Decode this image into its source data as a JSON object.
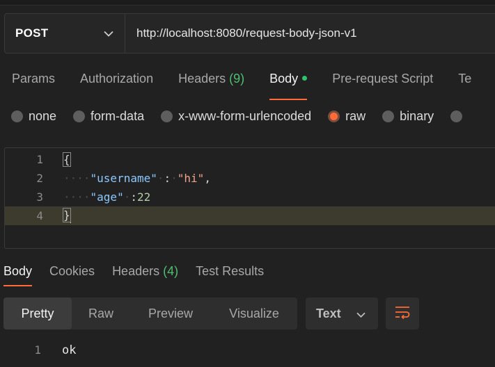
{
  "request": {
    "method": "POST",
    "url": "http://localhost:8080/request-body-json-v1"
  },
  "request_tabs": {
    "params": "Params",
    "authorization": "Authorization",
    "headers": "Headers",
    "headers_count": "(9)",
    "body": "Body",
    "pre_request": "Pre-request Script",
    "tests_partial": "Te"
  },
  "body_types": {
    "none": "none",
    "form_data": "form-data",
    "urlencoded": "x-www-form-urlencoded",
    "raw": "raw",
    "binary": "binary",
    "selected": "raw"
  },
  "editor": {
    "line_numbers": [
      "1",
      "2",
      "3",
      "4"
    ],
    "open_brace": "{",
    "key_username": "\"username\"",
    "colon1": ":",
    "value_username": "\"hi\"",
    "comma": ",",
    "key_age": "\"age\"",
    "colon2": ":",
    "value_age": "22",
    "close_brace": "}"
  },
  "response_tabs": {
    "body": "Body",
    "cookies": "Cookies",
    "headers": "Headers",
    "headers_count": "(4)",
    "test_results": "Test Results"
  },
  "response_view": {
    "pretty": "Pretty",
    "raw": "Raw",
    "preview": "Preview",
    "visualize": "Visualize",
    "selected": "Pretty",
    "format": "Text"
  },
  "response_body": {
    "line_number": "1",
    "content": "ok"
  },
  "colors": {
    "accent": "#ff6c37",
    "active_dot": "#2ec46e",
    "count": "#4fbf70",
    "background": "#212121"
  },
  "icons": {
    "method_dropdown": "chevron-down-icon",
    "format_dropdown": "chevron-down-icon",
    "wrap": "wrap-lines-icon"
  }
}
